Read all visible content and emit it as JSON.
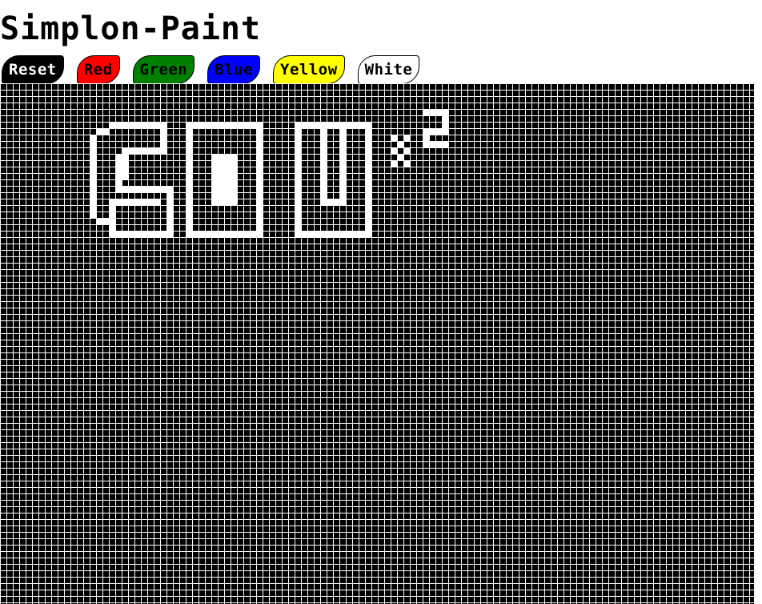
{
  "app": {
    "title": "Simplon-Paint"
  },
  "toolbar": {
    "buttons": [
      {
        "label": "Reset",
        "bg": "#000000",
        "fg": "#ffffff"
      },
      {
        "label": "Red",
        "bg": "#ff0000",
        "fg": "#000000"
      },
      {
        "label": "Green",
        "bg": "#008000",
        "fg": "#000000"
      },
      {
        "label": "Blue",
        "bg": "#0000ff",
        "fg": "#000000"
      },
      {
        "label": "Yellow",
        "bg": "#ffff00",
        "fg": "#000000"
      },
      {
        "label": "White",
        "bg": "#ffffff",
        "fg": "#000000"
      }
    ]
  },
  "canvas": {
    "cell_fill": "#000000",
    "grid_line": "#ffffff",
    "painted_text": "SOU",
    "painted_superscript": "x2"
  }
}
